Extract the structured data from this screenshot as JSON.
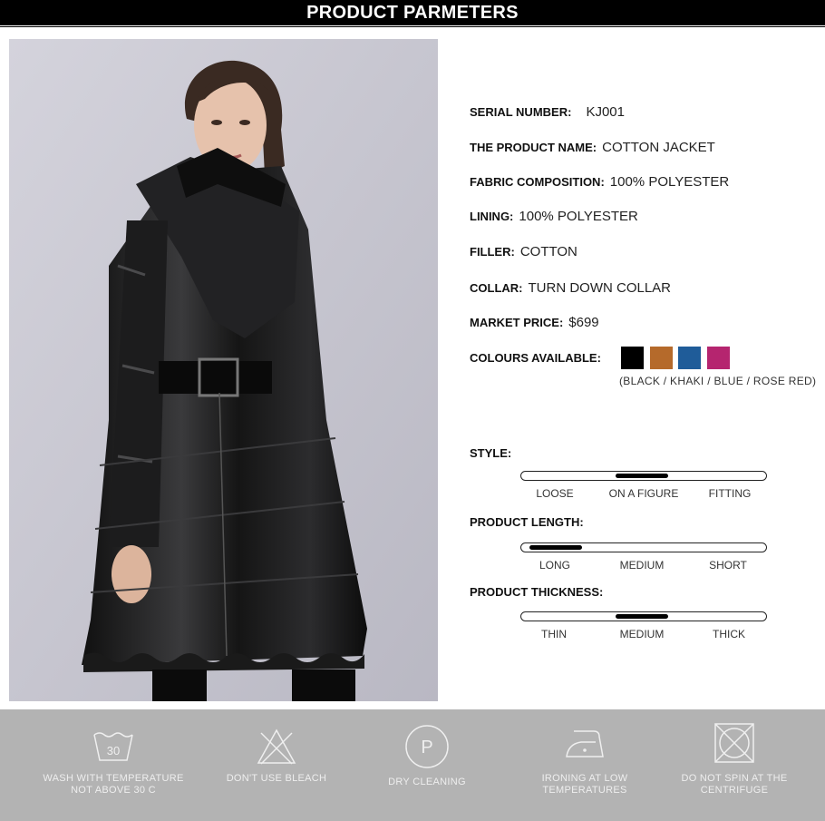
{
  "header": {
    "title": "PRODUCT PARMETERS"
  },
  "specs": {
    "serial_key": "SERIAL NUMBER:",
    "serial_val": "KJ001",
    "name_key": "THE PRODUCT NAME:",
    "name_val": "COTTON JACKET",
    "fabric_key": "FABRIC COMPOSITION:",
    "fabric_val": "100% POLYESTER",
    "lining_key": "LINING:",
    "lining_val": "100% POLYESTER",
    "filler_key": "FILLER:",
    "filler_val": "COTTON",
    "collar_key": "COLLAR:",
    "collar_val": "TURN DOWN COLLAR",
    "price_key": "MARKET PRICE:",
    "price_val": "$699",
    "colours_key": "COLOURS AVAILABLE:",
    "colours_names": "(BLACK / KHAKI / BLUE / ROSE RED)"
  },
  "colours": [
    "#000000",
    "#b56a2b",
    "#1f5c99",
    "#b5256f"
  ],
  "style": {
    "title": "STYLE:",
    "labels": [
      "LOOSE",
      "ON A FIGURE",
      "FITTING"
    ],
    "selected": "ON A FIGURE"
  },
  "length": {
    "title": "PRODUCT LENGTH:",
    "labels": [
      "LONG",
      "MEDIUM",
      "SHORT"
    ],
    "selected": "LONG"
  },
  "thickness": {
    "title": "PRODUCT THICKNESS:",
    "labels": [
      "THIN",
      "MEDIUM",
      "THICK"
    ],
    "selected": "MEDIUM"
  },
  "care": {
    "wash_temp": "30",
    "wash_line1": "WASH WITH TEMPERATURE",
    "wash_line2": "NOT ABOVE 30 C",
    "bleach": "DON'T USE BLEACH",
    "dry_letter": "P",
    "dry": "DRY CLEANING",
    "iron_line1": "IRONING AT LOW",
    "iron_line2": "TEMPERATURES",
    "spin_line1": "DO NOT SPIN AT THE",
    "spin_line2": "CENTRIFUGE"
  }
}
